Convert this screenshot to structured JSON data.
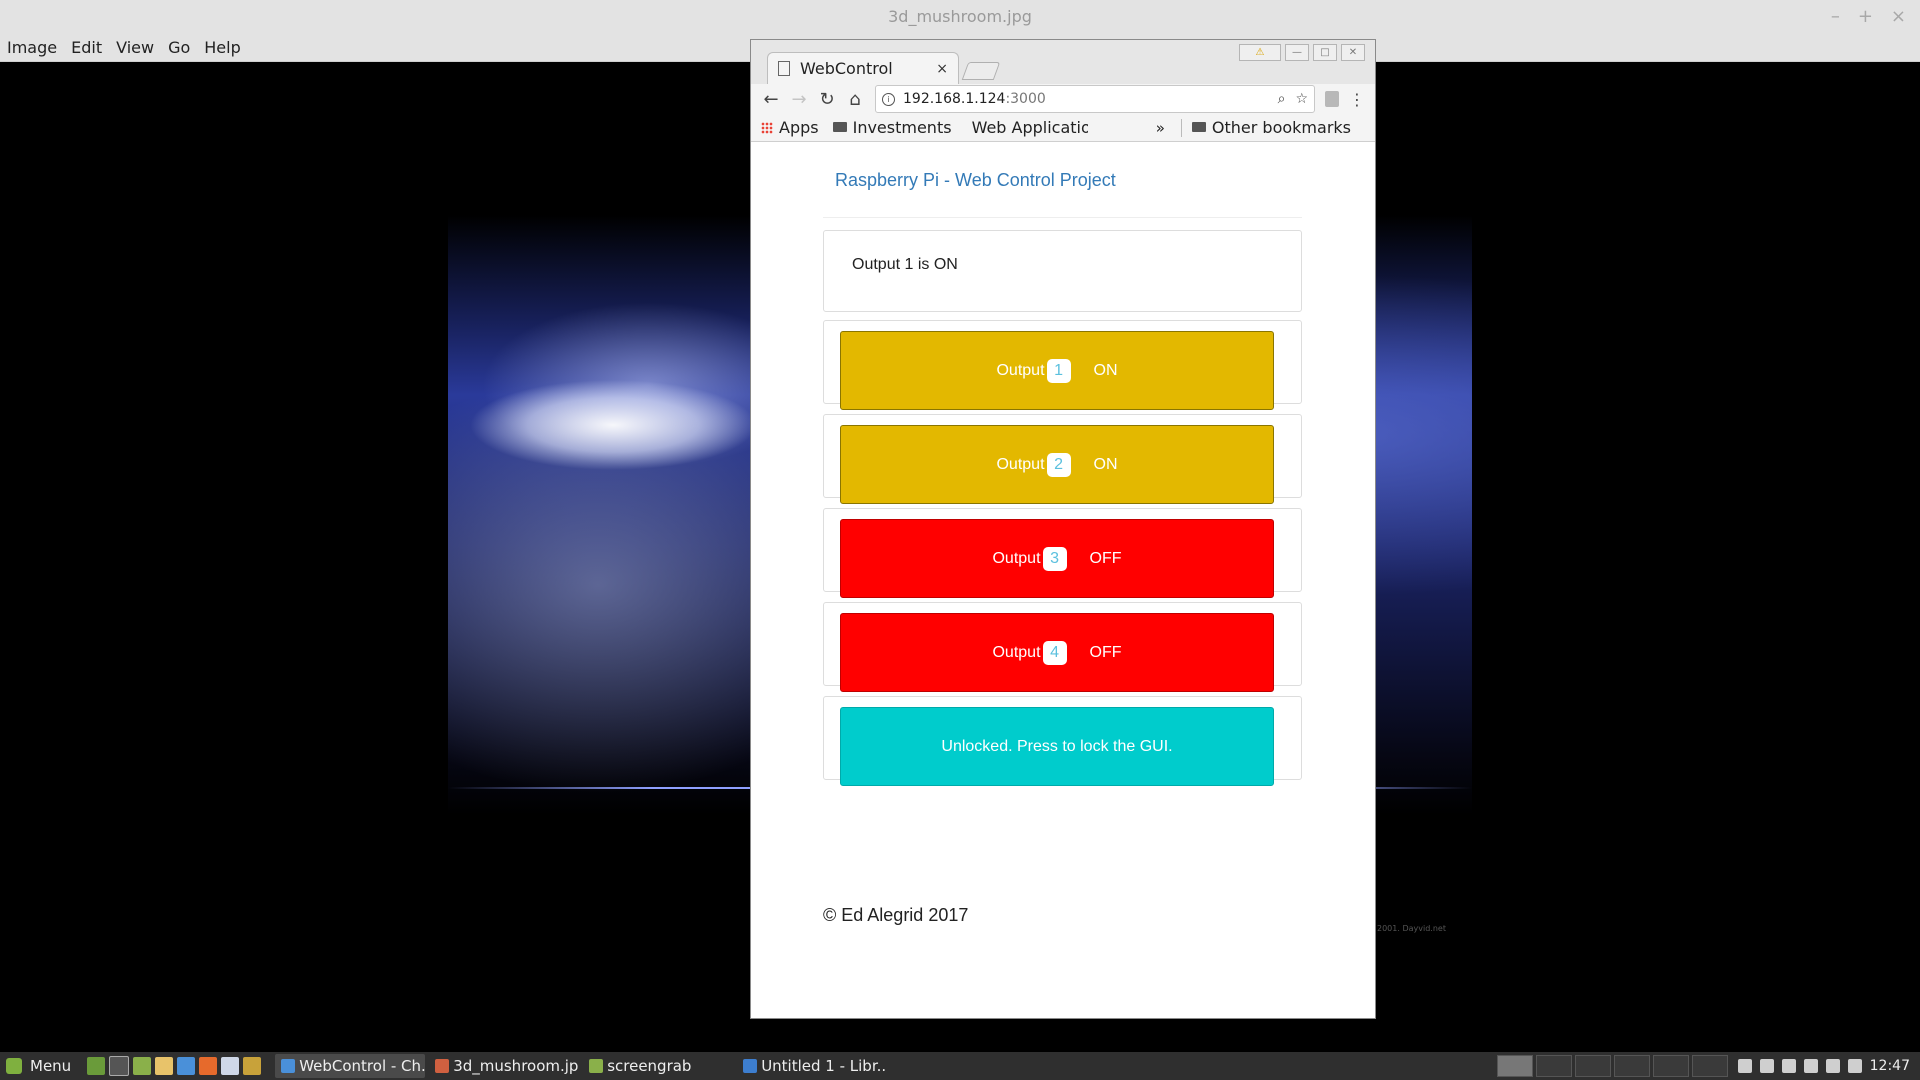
{
  "viewer": {
    "title": "3d_mushroom.jpg",
    "controls": [
      "–",
      "+",
      "×"
    ],
    "menu": [
      "Image",
      "Edit",
      "View",
      "Go",
      "Help"
    ],
    "wallpaper_credit": "2001. Dayvid.net"
  },
  "browser": {
    "tab_title": "WebControl",
    "tab_close": "×",
    "url_host": "192.168.1.124",
    "url_port": ":3000",
    "bookmarks": {
      "apps": "Apps",
      "investments": "Investments",
      "web_applications": "Web Applicatio",
      "chevron": "»",
      "other": "Other bookmarks"
    }
  },
  "page": {
    "title": "Raspberry Pi - Web Control Project",
    "status": "Output 1 is ON",
    "outputs": [
      {
        "label": "Output",
        "number": "1",
        "state": "ON"
      },
      {
        "label": "Output",
        "number": "2",
        "state": "ON"
      },
      {
        "label": "Output",
        "number": "3",
        "state": "OFF"
      },
      {
        "label": "Output",
        "number": "4",
        "state": "OFF"
      }
    ],
    "lock_button": "Unlocked. Press to lock the GUI.",
    "footer": "© Ed Alegrid 2017"
  },
  "taskbar": {
    "menu": "Menu",
    "tasks": [
      "WebControl - Ch...",
      "3d_mushroom.jpg",
      "screengrab",
      "Untitled 1 - Libr..."
    ],
    "clock": "12:47"
  },
  "colors": {
    "on": "#e3b800",
    "off": "#ff0000",
    "lock": "#00cccc",
    "title_link": "#337ab7"
  }
}
